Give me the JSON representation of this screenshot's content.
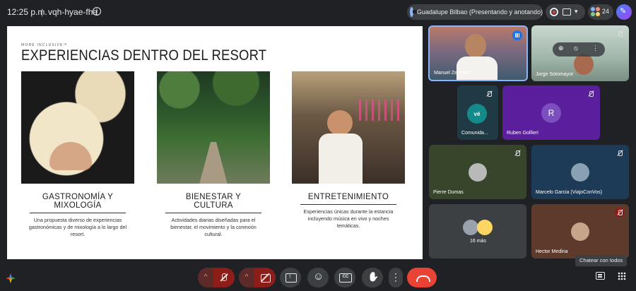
{
  "header": {
    "time": "12:25 p.m.",
    "separator": "|",
    "meeting_code": "vqh-hyae-fha",
    "presenter_label": "Guadalupe Bilbao (Presentando y anotando)",
    "participant_count": "24"
  },
  "slide": {
    "brand": "MORE INCLUSIVE™",
    "title": "EXPERIENCIAS DENTRO DEL RESORT",
    "columns": [
      {
        "heading": "GASTRONOMÍA Y MIXOLOGÍA",
        "description": "Una propuesta diverso de experiencias gastronómicas y de mixología a lo largo del resort."
      },
      {
        "heading": "BIENESTAR Y CULTURA",
        "description": "Actividades diarias diseñadas para el bienestar, el movimiento y la conexión cultural."
      },
      {
        "heading": "ENTRETENIMIENTO",
        "description": "Experiencias únicas durante la estancia incluyendo música en vivo y noches temáticas."
      }
    ]
  },
  "participants": [
    {
      "name": "Manuel Zenteno"
    },
    {
      "name": "Jorge Sotomayor"
    },
    {
      "name": "Comunida...",
      "avatar_text": "vé"
    },
    {
      "name": "Ruben Golfieri",
      "avatar_letter": "R"
    },
    {
      "name": "Pierre Dumas"
    },
    {
      "name": "Marcelo Garcia (ViajoConVos)"
    },
    {
      "name": "16 más"
    },
    {
      "name": "Hector Medina"
    }
  ],
  "footer": {
    "chat_tooltip": "Chatear con todos",
    "caret": "^"
  },
  "colors": {
    "background": "#202124",
    "leave": "#ea4335",
    "muted_control": "#8c1d18",
    "accent_blue": "#1a73e8",
    "ruben_tile": "#5b1f9e"
  }
}
